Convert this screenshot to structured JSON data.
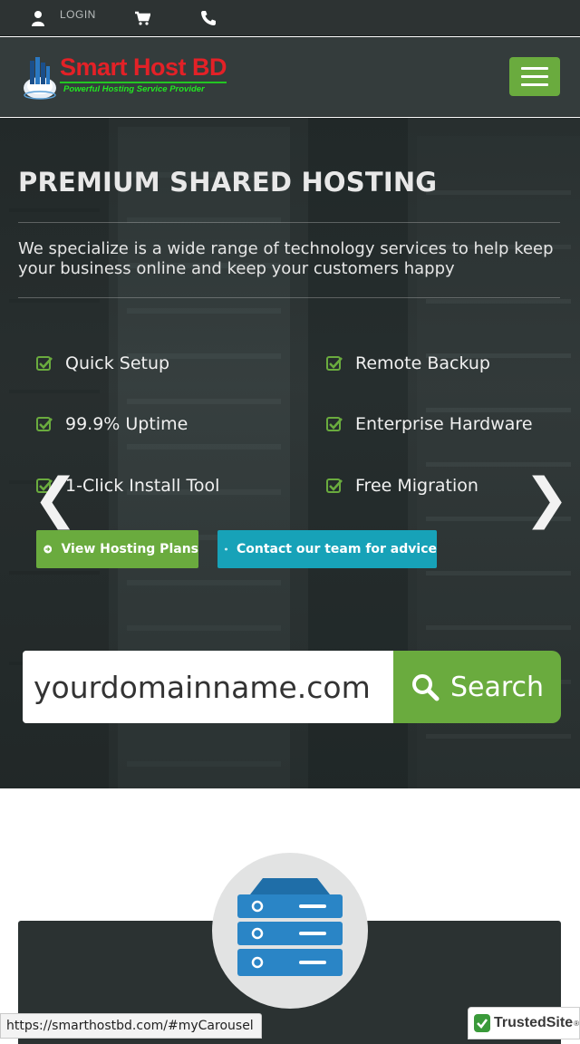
{
  "topbar": {
    "login_label": "LOGIN",
    "icons": [
      "user-icon",
      "cart-icon",
      "phone-icon"
    ]
  },
  "header": {
    "logo_title": "Smart Host BD",
    "logo_tagline": "Powerful Hosting Service Provider",
    "menu_icon": "hamburger-icon"
  },
  "hero": {
    "title": "PREMIUM SHARED HOSTING",
    "description": "We specialize is a wide range of technology services to help keep your business online and keep your customers happy",
    "features_left": [
      "Quick Setup",
      "99.9% Uptime",
      "1-Click Install Tool"
    ],
    "features_right": [
      "Remote Backup",
      "Enterprise Hardware",
      "Free Migration"
    ],
    "prev_arrow": "❮",
    "next_arrow": "❯",
    "buttons": {
      "view_plans": "View Hosting Plans",
      "contact": "Contact our team for advice"
    },
    "search": {
      "placeholder": "yourdomainname.com",
      "button_label": "Search"
    }
  },
  "status_bar": {
    "url": "https://smarthostbd.com/#myCarousel"
  },
  "trusted_badge": {
    "label": "TrustedSite",
    "tm": "®"
  },
  "colors": {
    "accent_green": "#6aab3e",
    "accent_blue": "#17a2b8",
    "brand_red": "#e32127",
    "topbar_bg": "#2d3333"
  }
}
